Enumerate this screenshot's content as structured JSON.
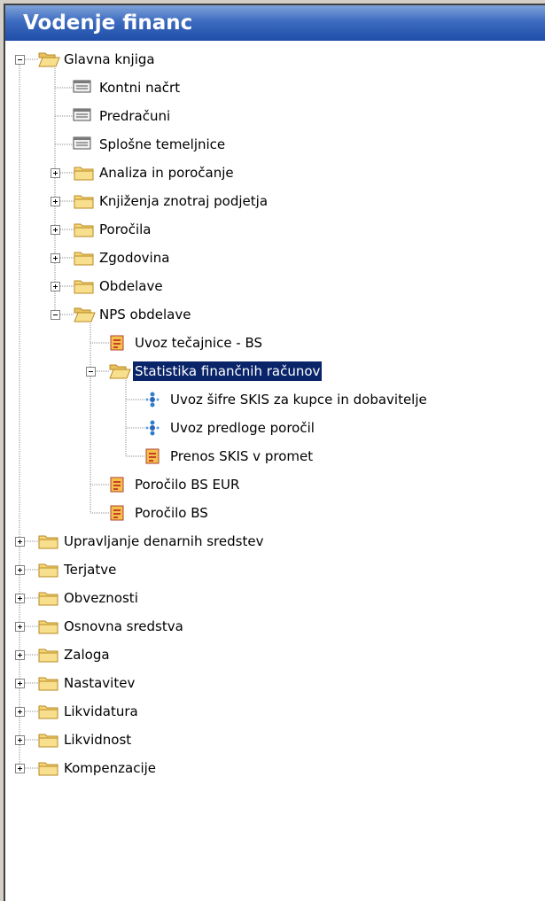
{
  "window": {
    "title": "Vodenje financ"
  },
  "colors": {
    "title_bar": "#1f4ea8",
    "selection": "#0a246a",
    "folder_yellow": "#f5d67a"
  },
  "tree": {
    "nodes": [
      {
        "label": "Glavna knjiga",
        "icon": "folder-open-icon",
        "expander": "minus"
      },
      {
        "label": "Kontni načrt",
        "icon": "table-form-icon"
      },
      {
        "label": "Predračuni",
        "icon": "table-form-icon"
      },
      {
        "label": "Splošne temeljnice",
        "icon": "table-form-icon"
      },
      {
        "label": "Analiza in poročanje",
        "icon": "folder-closed-icon",
        "expander": "plus"
      },
      {
        "label": "Knjiženja znotraj podjetja",
        "icon": "folder-closed-icon",
        "expander": "plus"
      },
      {
        "label": "Poročila",
        "icon": "folder-closed-icon",
        "expander": "plus"
      },
      {
        "label": "Zgodovina",
        "icon": "folder-closed-icon",
        "expander": "plus"
      },
      {
        "label": "Obdelave",
        "icon": "folder-closed-icon",
        "expander": "plus"
      },
      {
        "label": "NPS obdelave",
        "icon": "folder-open-icon",
        "expander": "minus"
      },
      {
        "label": "Uvoz tečajnice - BS",
        "icon": "report-icon"
      },
      {
        "label": "Statistika finančnih računov",
        "icon": "folder-open-icon",
        "expander": "minus",
        "selected": true
      },
      {
        "label": "Uvoz šifre SKIS za kupce in dobavitelje",
        "icon": "dataport-icon"
      },
      {
        "label": "Uvoz predloge poročil",
        "icon": "dataport-icon"
      },
      {
        "label": "Prenos SKIS v promet",
        "icon": "report-icon"
      },
      {
        "label": "Poročilo BS EUR",
        "icon": "report-icon"
      },
      {
        "label": "Poročilo BS",
        "icon": "report-icon"
      },
      {
        "label": "Upravljanje denarnih sredstev",
        "icon": "folder-closed-icon",
        "expander": "plus"
      },
      {
        "label": "Terjatve",
        "icon": "folder-closed-icon",
        "expander": "plus"
      },
      {
        "label": "Obveznosti",
        "icon": "folder-closed-icon",
        "expander": "plus"
      },
      {
        "label": "Osnovna sredstva",
        "icon": "folder-closed-icon",
        "expander": "plus"
      },
      {
        "label": "Zaloga",
        "icon": "folder-closed-icon",
        "expander": "plus"
      },
      {
        "label": "Nastavitev",
        "icon": "folder-closed-icon",
        "expander": "plus"
      },
      {
        "label": "Likvidatura",
        "icon": "folder-closed-icon",
        "expander": "plus"
      },
      {
        "label": "Likvidnost",
        "icon": "folder-closed-icon",
        "expander": "plus"
      },
      {
        "label": "Kompenzacije",
        "icon": "folder-closed-icon",
        "expander": "plus"
      }
    ]
  }
}
